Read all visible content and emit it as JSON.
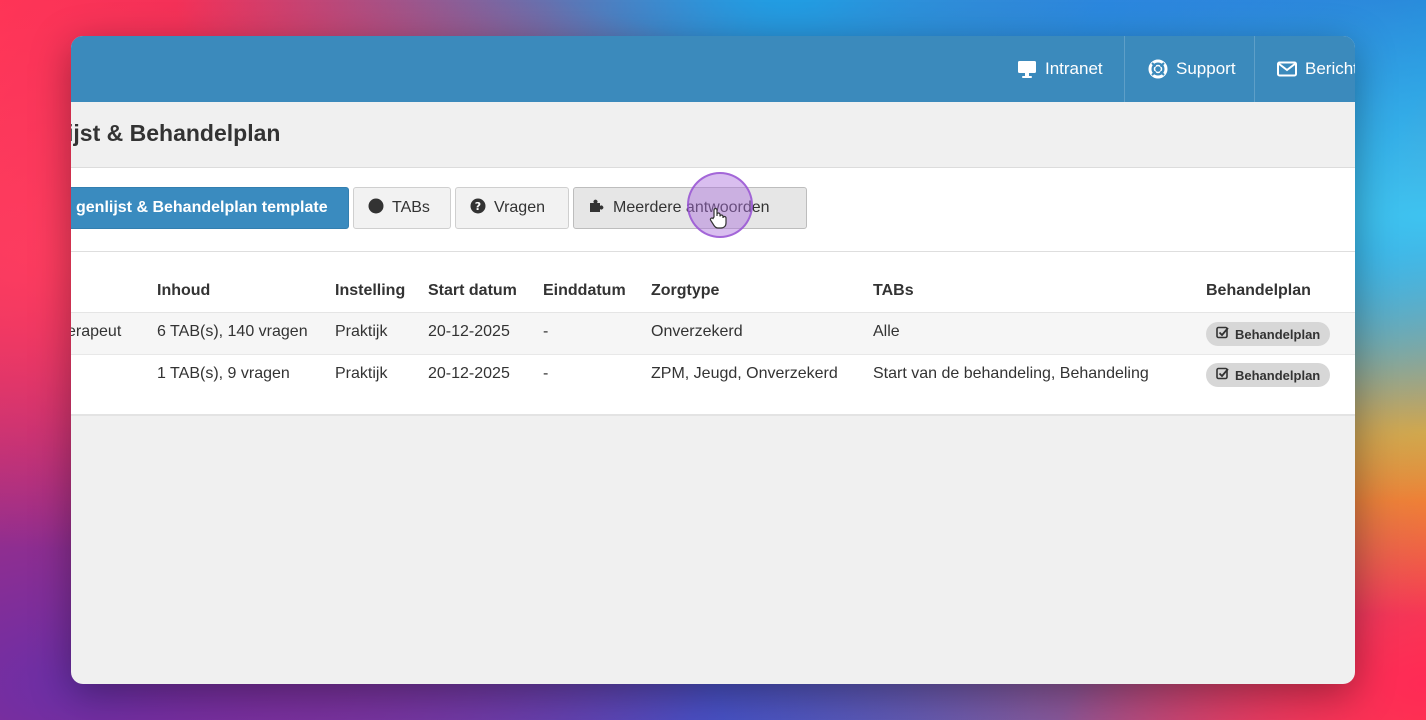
{
  "topnav": {
    "intranet": "Intranet",
    "support": "Support",
    "berichten": "Bericht"
  },
  "page": {
    "title": "ijst & Behandelplan"
  },
  "toolbar": {
    "template_label": "genlijst & Behandelplan template",
    "tabs_label": "TABs",
    "vragen_label": "Vragen",
    "meerdere_label": "Meerdere antwoorden"
  },
  "table": {
    "headers": {
      "inhoud": "Inhoud",
      "instelling": "Instelling",
      "start_datum": "Start datum",
      "einddatum": "Einddatum",
      "zorgtype": "Zorgtype",
      "tabs": "TABs",
      "behandelplan": "Behandelplan"
    },
    "rows": [
      {
        "naam": "erapeut",
        "inhoud": "6 TAB(s), 140 vragen",
        "instelling": "Praktijk",
        "start_datum": "20-12-2025",
        "einddatum": "-",
        "zorgtype": "Onverzekerd",
        "tabs": "Alle",
        "behandelplan": "Behandelplan"
      },
      {
        "naam": "",
        "inhoud": "1 TAB(s), 9 vragen",
        "instelling": "Praktijk",
        "start_datum": "20-12-2025",
        "einddatum": "-",
        "zorgtype": "ZPM, Jeugd, Onverzekerd",
        "tabs": "Start van de behandeling, Behandeling",
        "behandelplan": "Behandelplan"
      }
    ]
  },
  "colors": {
    "topbar": "#3b8abc",
    "primary_button": "#3a8bbf",
    "badge": "#d7d7d7"
  }
}
